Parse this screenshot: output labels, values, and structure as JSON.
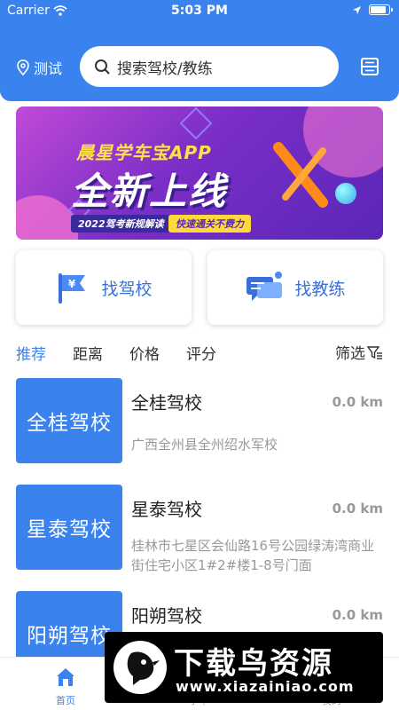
{
  "status_bar": {
    "carrier": "Carrier",
    "time": "5:03 PM"
  },
  "header": {
    "location": "测试",
    "search_placeholder": "搜索驾校/教练",
    "accent_color": "#3a82ee"
  },
  "banner": {
    "subtitle": "晨星学车宝APP",
    "title": "全新上线",
    "tag1": "2022驾考新规解读",
    "tag2": "快速通关不费力"
  },
  "quick_actions": [
    {
      "label": "找驾校",
      "icon": "flag-yuan-icon"
    },
    {
      "label": "找教练",
      "icon": "chat-bubbles-icon"
    }
  ],
  "tabs": [
    "推荐",
    "距离",
    "价格",
    "评分"
  ],
  "filter_label": "筛选",
  "schools": [
    {
      "thumb": "全桂驾校",
      "name": "全桂驾校",
      "distance": "0.0 km",
      "address": "广西全州县全州绍水军校"
    },
    {
      "thumb": "星泰驾校",
      "name": "星泰驾校",
      "distance": "0.0 km",
      "address": "桂林市七星区会仙路16号公园绿涛湾商业街住宅小区1#2#楼1-8号门面"
    },
    {
      "thumb": "阳朔驾校",
      "name": "阳朔驾校",
      "distance": "0.0 km",
      "address": ""
    }
  ],
  "bottom_nav": [
    {
      "label": "首页",
      "icon": "home-icon"
    },
    {
      "label": "学车",
      "icon": "car-icon"
    },
    {
      "label": "我的",
      "icon": "user-icon"
    }
  ],
  "watermark": {
    "brand": "下载鸟资源",
    "url": "www.xiazainiao.com"
  }
}
